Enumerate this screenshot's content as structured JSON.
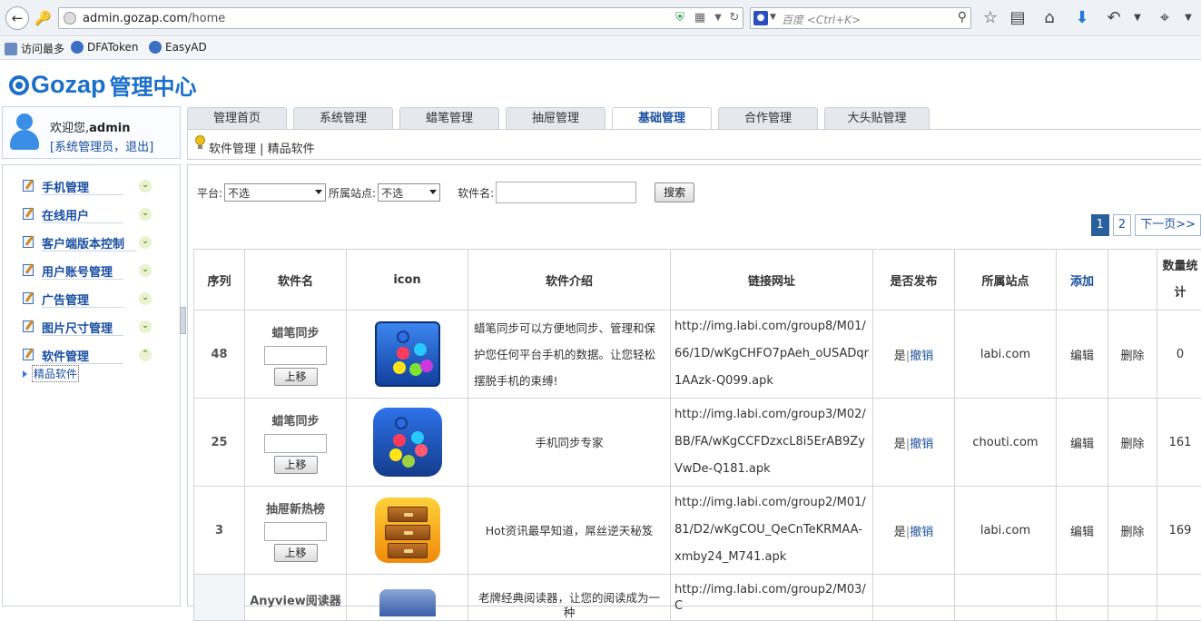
{
  "browser": {
    "url_host": "admin.gozap.com",
    "url_path": "/home",
    "search_placeholder": "百度 <Ctrl+K>",
    "bookmarks": [
      "访问最多",
      "DFAToken",
      "EasyAD"
    ]
  },
  "header": {
    "logo_brand": "Gozap",
    "logo_suffix": "管理中心"
  },
  "user": {
    "welcome_prefix": "欢迎您,",
    "username": "admin",
    "role_links": "[系统管理员，退出]"
  },
  "tabs": [
    {
      "label": "管理首页"
    },
    {
      "label": "系统管理"
    },
    {
      "label": "蜡笔管理"
    },
    {
      "label": "抽屉管理"
    },
    {
      "label": "基础管理",
      "active": true
    },
    {
      "label": "合作管理"
    },
    {
      "label": "大头贴管理"
    }
  ],
  "subnav": {
    "text": "软件管理 | 精品软件"
  },
  "sidebar": {
    "items": [
      {
        "label": "手机管理"
      },
      {
        "label": "在线用户"
      },
      {
        "label": "客户端版本控制"
      },
      {
        "label": "用户账号管理"
      },
      {
        "label": "广告管理"
      },
      {
        "label": "图片尺寸管理"
      },
      {
        "label": "软件管理",
        "expanded": true
      }
    ],
    "subitem": "精品软件"
  },
  "filters": {
    "platform_label": "平台:",
    "platform_value": "不选",
    "site_label": "所属站点:",
    "site_value": "不选",
    "name_label": "软件名:",
    "search_button": "搜索"
  },
  "pager": {
    "pages": [
      "1",
      "2"
    ],
    "current": "1",
    "next": "下一页>>"
  },
  "table": {
    "headers": [
      "序列",
      "软件名",
      "icon",
      "软件介绍",
      "链接网址",
      "是否发布",
      "所属站点",
      "添加",
      "",
      "数量统计"
    ],
    "move_up_label": "上移",
    "published_yes": "是",
    "revoke_label": "撤销",
    "edit_label": "编辑",
    "delete_label": "删除",
    "rows": [
      {
        "seq": "48",
        "name": "蜡笔同步",
        "icon": "crayon-sync-icon",
        "intro": "蜡笔同步可以方便地同步、管理和保护您任何平台手机的数据。让您轻松摆脱手机的束缚!",
        "url": "http://img.labi.com/group8/M01/66/1D/wKgCHFO7pAeh_oUSADqr1AAzk-Q099.apk",
        "site": "labi.com",
        "count": "0"
      },
      {
        "seq": "25",
        "name": "蜡笔同步",
        "icon": "crayon-sync-round-icon",
        "intro": "手机同步专家",
        "url": "http://img.labi.com/group3/M02/BB/FA/wKgCCFDzxcL8i5ErAB9ZyVwDe-Q181.apk",
        "site": "chouti.com",
        "count": "161"
      },
      {
        "seq": "3",
        "name": "抽屉新热榜",
        "icon": "drawer-cabinet-icon",
        "intro": "Hot资讯最早知道，屌丝逆天秘笈",
        "url": "http://img.labi.com/group2/M01/81/D2/wKgCOU_QeCnTeKRMAA-xmby24_M741.apk",
        "site": "labi.com",
        "count": "169"
      }
    ],
    "partial_row": {
      "name": "Anyview阅读器",
      "intro": "老牌经典阅读器，让您的阅读成为一种",
      "url": "http://img.labi.com/group2/M03/C"
    }
  },
  "colors": {
    "accent": "#1a4fa0",
    "logo": "#1a6fc9",
    "pager_current": "#2a5f9e"
  }
}
